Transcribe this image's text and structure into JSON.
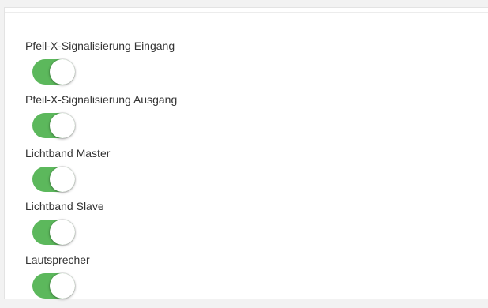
{
  "settings": [
    {
      "label": "Pfeil-X-Signalisierung Eingang",
      "checked": true
    },
    {
      "label": "Pfeil-X-Signalisierung Ausgang",
      "checked": true
    },
    {
      "label": "Lichtband Master",
      "checked": true
    },
    {
      "label": "Lichtband Slave",
      "checked": true
    },
    {
      "label": "Lautsprecher",
      "checked": true
    }
  ],
  "colors": {
    "toggle_on": "#5cb85c",
    "knob": "#ffffff",
    "label_text": "#333333",
    "panel_background": "#ffffff",
    "page_background": "#f2f2f2"
  }
}
